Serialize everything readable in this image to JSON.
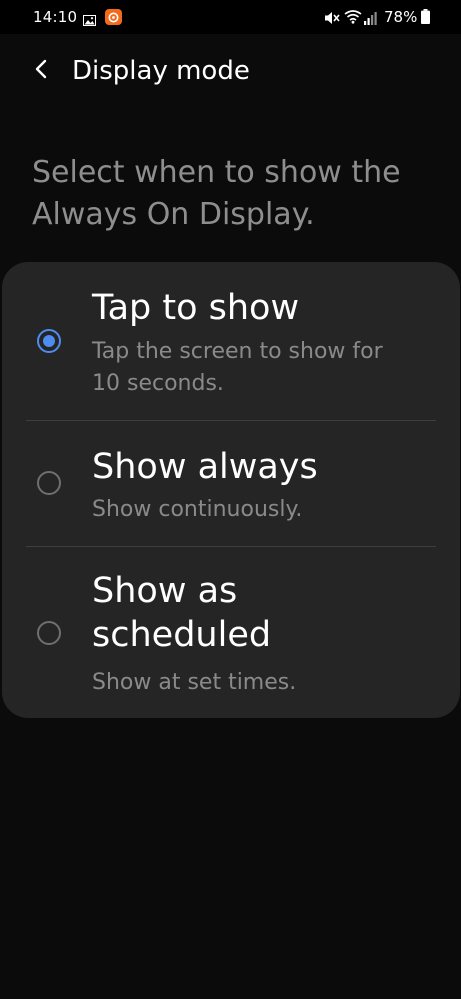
{
  "status_bar": {
    "time": "14:10",
    "battery_percent": "78%",
    "icons": [
      "gallery-icon",
      "app-notification-icon",
      "mute-icon",
      "wifi-icon",
      "signal-icon",
      "battery-icon"
    ]
  },
  "header": {
    "title": "Display mode",
    "back_icon": "chevron-left-icon"
  },
  "description": "Select when to show the Always On Display.",
  "options": [
    {
      "title": "Tap to show",
      "summary": "Tap the screen to show for 10 seconds.",
      "selected": true
    },
    {
      "title": "Show always",
      "summary": "Show continuously.",
      "selected": false
    },
    {
      "title": "Show as scheduled",
      "summary": "Show at set times.",
      "selected": false
    }
  ],
  "colors": {
    "background": "#000000",
    "card": "#252525",
    "accent": "#4e8cf0",
    "secondary_text": "#8a8a8a",
    "notification_app": "#f26a1b"
  }
}
